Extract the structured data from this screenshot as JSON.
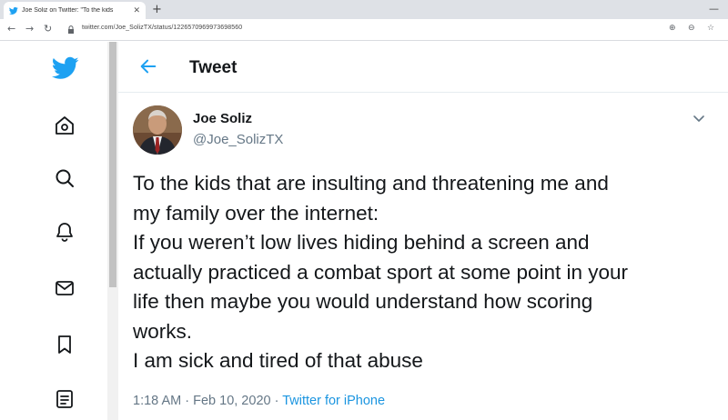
{
  "browser": {
    "tab_title": "Joe Soliz on Twitter: \"To the kids",
    "url": "twitter.com/Joe_SolizTX/status/1226570969973698560",
    "icons": [
      "twitter-favicon",
      "close-icon",
      "new-tab-icon",
      "back-icon",
      "forward-icon",
      "reload-icon",
      "lock-icon",
      "extension-icon",
      "zoom-icon",
      "star-icon",
      "minimize-icon"
    ]
  },
  "nav": {
    "icons": [
      "twitter-logo-icon",
      "home-icon",
      "explore-icon",
      "notifications-icon",
      "messages-icon",
      "bookmarks-icon",
      "lists-icon"
    ]
  },
  "header": {
    "title": "Tweet"
  },
  "tweet": {
    "author_name": "Joe Soliz",
    "author_handle": "@Joe_SolizTX",
    "lines": [
      "To the kids that are insulting and threatening me and",
      "my family over the internet:",
      "If you weren’t low lives hiding behind a screen and",
      "actually practiced a combat sport at some point in your",
      "life then maybe you would understand how scoring",
      "works.",
      "I am sick and tired of that abuse"
    ],
    "time": "1:18 AM",
    "date": "Feb 10, 2020",
    "separator": "·",
    "source": "Twitter for iPhone"
  },
  "colors": {
    "twitter_blue": "#1da1f2",
    "text": "#14171a",
    "secondary_text": "#657786",
    "link": "#1b95e0"
  }
}
